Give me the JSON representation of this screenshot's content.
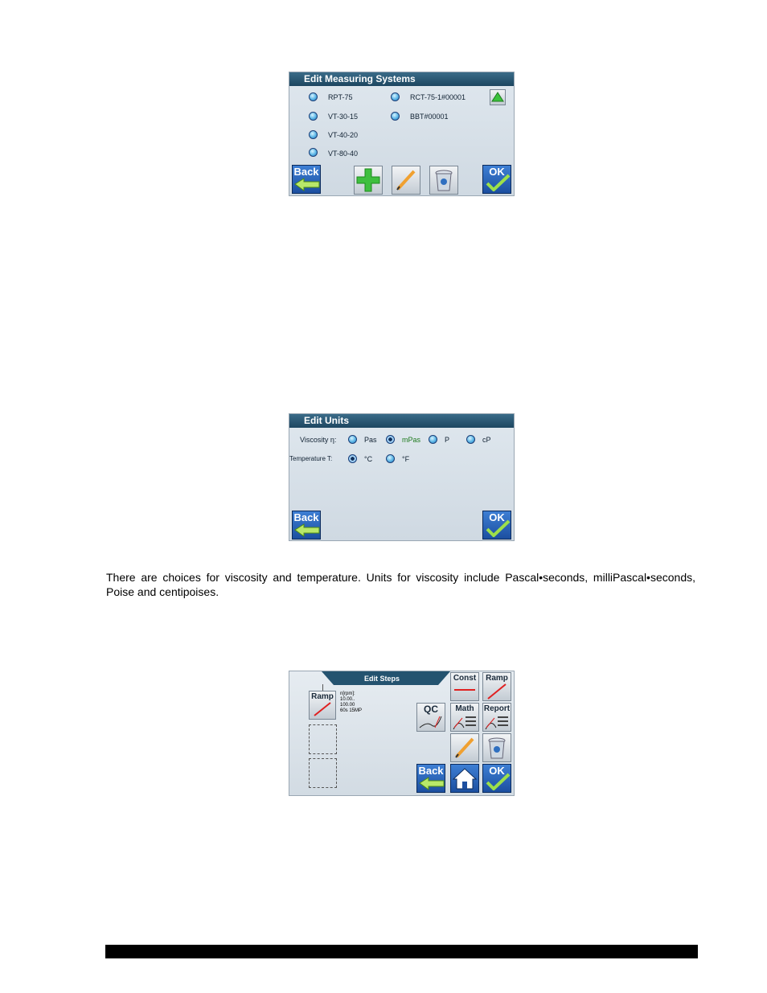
{
  "measuring_systems": {
    "title": "Edit Measuring Systems",
    "items": [
      "RPT-75",
      "VT-30-15",
      "VT-40-20",
      "VT-80-40",
      "RCT-75-1#00001",
      "BBT#00001"
    ],
    "back_label": "Back",
    "ok_label": "OK"
  },
  "units": {
    "title": "Edit Units",
    "viscosity_label": "Viscosity η:",
    "viscosity_options": [
      "Pas",
      "mPas",
      "P",
      "cP"
    ],
    "viscosity_selected": "mPas",
    "temperature_label": "Temperature T:",
    "temperature_options": [
      "°C",
      "°F"
    ],
    "temperature_selected": "°C",
    "back_label": "Back",
    "ok_label": "OK"
  },
  "description": "There are choices for viscosity and temperature.  Units for viscosity include Pascal•seconds, milliPascal•seconds, Poise and centipoises.",
  "steps": {
    "title": "Edit Steps",
    "step1_label": "Ramp",
    "step1_info": [
      "n[rpm]:",
      "10.00..",
      "100.00",
      "60s 15MP"
    ],
    "btn_const": "Const",
    "btn_ramp": "Ramp",
    "btn_qc": "QC",
    "btn_math": "Math",
    "btn_report": "Report",
    "back_label": "Back",
    "ok_label": "OK"
  }
}
